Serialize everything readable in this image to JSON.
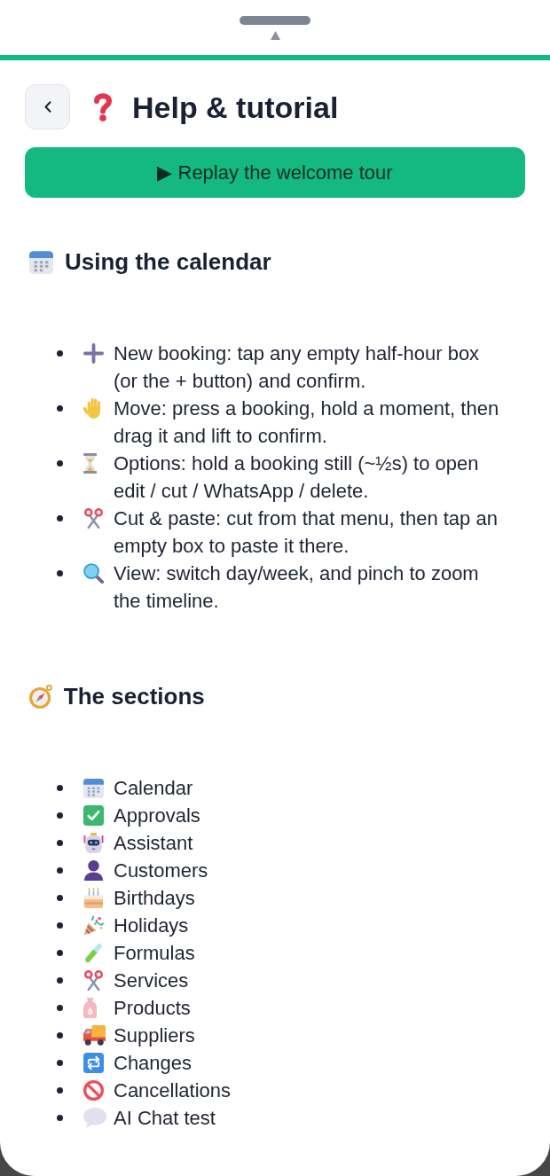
{
  "header": {
    "title": "Help & tutorial"
  },
  "tour_button": {
    "label": "▶ Replay the welcome tour"
  },
  "sections": [
    {
      "heading": "Using the calendar",
      "items": [
        "New booking: tap any empty half-hour box (or the + button) and confirm.",
        "Move: press a booking, hold a moment, then drag it and lift to confirm.",
        "Options: hold a booking still (~½s) to open edit / cut / WhatsApp / delete.",
        "Cut & paste: cut from that menu, then tap an empty box to paste it there.",
        "View: switch day/week, and pinch to zoom the timeline."
      ]
    },
    {
      "heading": "The sections",
      "items": [
        "Calendar",
        "Approvals",
        "Assistant",
        "Customers",
        "Birthdays",
        "Holidays",
        "Formulas",
        "Services",
        "Products",
        "Suppliers",
        "Changes",
        "Cancellations",
        "AI Chat test"
      ]
    }
  ]
}
